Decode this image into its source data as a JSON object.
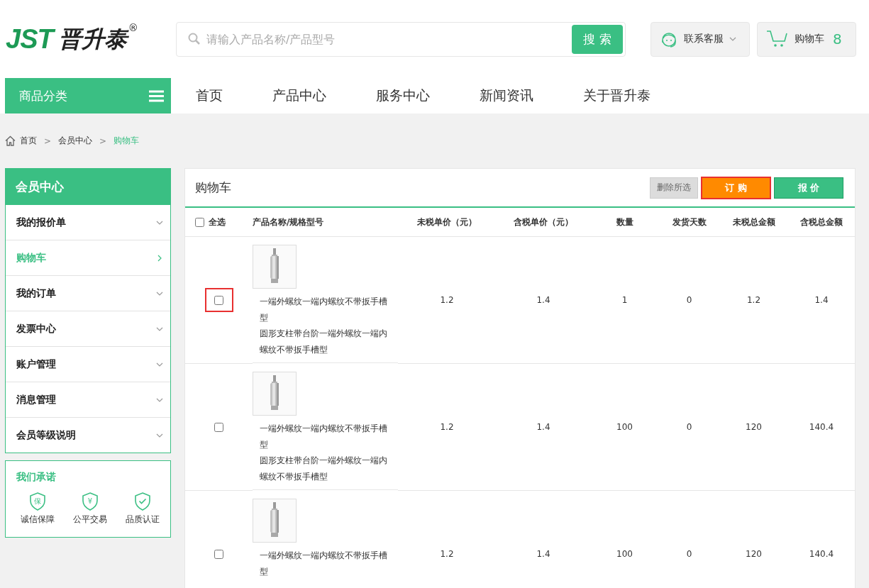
{
  "header": {
    "logo": {
      "mark": "JST",
      "name": "晋升泰",
      "reg": "®"
    },
    "search": {
      "placeholder": "请输入产品名称/产品型号",
      "button": "搜 索"
    },
    "service": {
      "label": "联系客服"
    },
    "cart": {
      "label": "购物车",
      "count": "8"
    }
  },
  "nav": {
    "category": "商品分类",
    "items": [
      {
        "label": "首页"
      },
      {
        "label": "产品中心"
      },
      {
        "label": "服务中心"
      },
      {
        "label": "新闻资讯"
      },
      {
        "label": "关于晋升泰"
      }
    ]
  },
  "breadcrumb": {
    "separator": ">",
    "items": [
      {
        "label": "首页",
        "current": false
      },
      {
        "label": "会员中心",
        "current": false
      },
      {
        "label": "购物车",
        "current": true
      }
    ]
  },
  "sidebar": {
    "title": "会员中心",
    "items": [
      {
        "label": "我的报价单",
        "selected": false
      },
      {
        "label": "购物车",
        "selected": true
      },
      {
        "label": "我的订单",
        "selected": false
      },
      {
        "label": "发票中心",
        "selected": false
      },
      {
        "label": "账户管理",
        "selected": false
      },
      {
        "label": "消息管理",
        "selected": false
      },
      {
        "label": "会员等级说明",
        "selected": false
      }
    ],
    "promise": {
      "title": "我们承诺",
      "items": [
        {
          "label": "诚信保障",
          "kind": "glyph",
          "glyph": "保"
        },
        {
          "label": "公平交易",
          "kind": "glyph",
          "glyph": "¥"
        },
        {
          "label": "品质认证",
          "kind": "check"
        }
      ]
    }
  },
  "cart": {
    "title": "购物车",
    "actions": [
      {
        "label": "删除所选",
        "kind": "delete",
        "highlighted": false
      },
      {
        "label": "订 购",
        "kind": "order",
        "highlighted": true
      },
      {
        "label": "报 价",
        "kind": "quote",
        "highlighted": false
      }
    ],
    "select_all": {
      "label": "全选",
      "checked": false
    },
    "columns": [
      "产品名称/规格型号",
      "未税单价（元）",
      "含税单价（元）",
      "数量",
      "发货天数",
      "未税总金额",
      "含税总金额"
    ],
    "rows": [
      {
        "checked": false,
        "highlighted": true,
        "name": "一端外螺纹一端内螺纹不带扳手槽型",
        "spec": "圆形支柱带台阶一端外螺纹一端内螺纹不带扳手槽型",
        "values": [
          "1.2",
          "1.4",
          "1",
          "0",
          "1.2",
          "1.4"
        ]
      },
      {
        "checked": false,
        "highlighted": false,
        "name": "一端外螺纹一端内螺纹不带扳手槽型",
        "spec": "圆形支柱带台阶一端外螺纹一端内螺纹不带扳手槽型",
        "values": [
          "1.2",
          "1.4",
          "100",
          "0",
          "120",
          "140.4"
        ]
      },
      {
        "checked": false,
        "highlighted": false,
        "name": "一端外螺纹一端内螺纹不带扳手槽型",
        "values": [
          "1.2",
          "1.4",
          "100",
          "0",
          "120",
          "140.4"
        ]
      }
    ]
  }
}
